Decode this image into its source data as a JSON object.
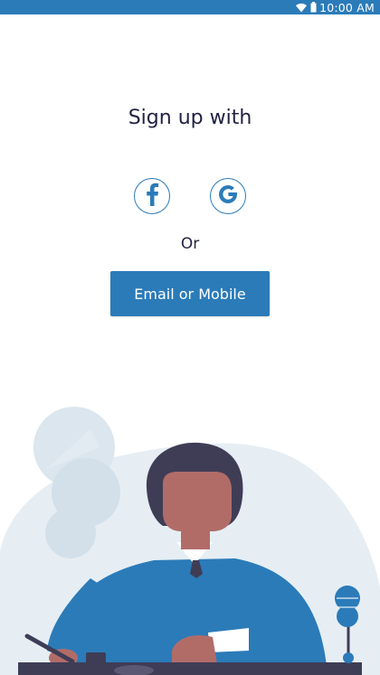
{
  "status_bar": {
    "time": "10:00 AM",
    "icons": [
      "wifi-icon",
      "battery-icon"
    ]
  },
  "signup": {
    "title": "Sign up with",
    "or_label": "Or",
    "email_button_label": "Email or Mobile",
    "social": [
      {
        "name": "facebook",
        "icon": "facebook-icon"
      },
      {
        "name": "google",
        "icon": "google-icon"
      }
    ]
  },
  "colors": {
    "accent": "#2b7bb9",
    "text": "#222244",
    "illustration_bg": "#e6eef4",
    "skin": "#b16c68",
    "hair": "#3f3d56",
    "shirt": "#2b7bb9"
  }
}
